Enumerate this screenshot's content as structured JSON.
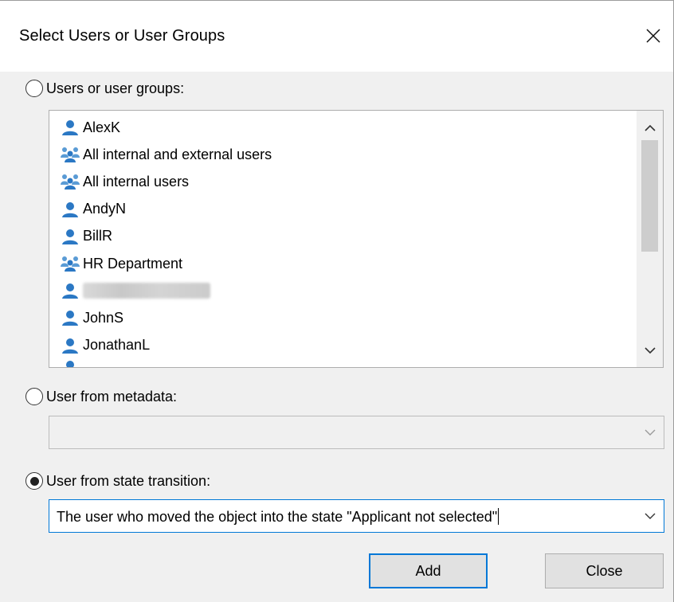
{
  "dialog": {
    "title": "Select Users or User Groups",
    "close_icon": "close-icon"
  },
  "options": {
    "users_groups_label": "Users or user groups:",
    "users_groups_selected": false,
    "metadata_label": "User from metadata:",
    "metadata_selected": false,
    "state_transition_label": "User from state transition:",
    "state_transition_selected": true
  },
  "list": {
    "items": [
      {
        "label": "AlexK",
        "icon": "user-icon"
      },
      {
        "label": "All internal and external users",
        "icon": "group-icon"
      },
      {
        "label": "All internal users",
        "icon": "group-icon"
      },
      {
        "label": "AndyN",
        "icon": "user-icon"
      },
      {
        "label": "BillR",
        "icon": "user-icon"
      },
      {
        "label": "HR Department",
        "icon": "group-icon"
      },
      {
        "label": "",
        "icon": "user-icon",
        "redacted": true
      },
      {
        "label": "JohnS",
        "icon": "user-icon"
      },
      {
        "label": "JonathanL",
        "icon": "user-icon"
      }
    ]
  },
  "metadata_combo": {
    "value": ""
  },
  "state_combo": {
    "value": "The user who moved the object into the state \"Applicant not selected\""
  },
  "buttons": {
    "add_label": "Add",
    "close_label": "Close"
  },
  "colors": {
    "user_icon": "#2b78c4",
    "focus_border": "#0078d7"
  }
}
